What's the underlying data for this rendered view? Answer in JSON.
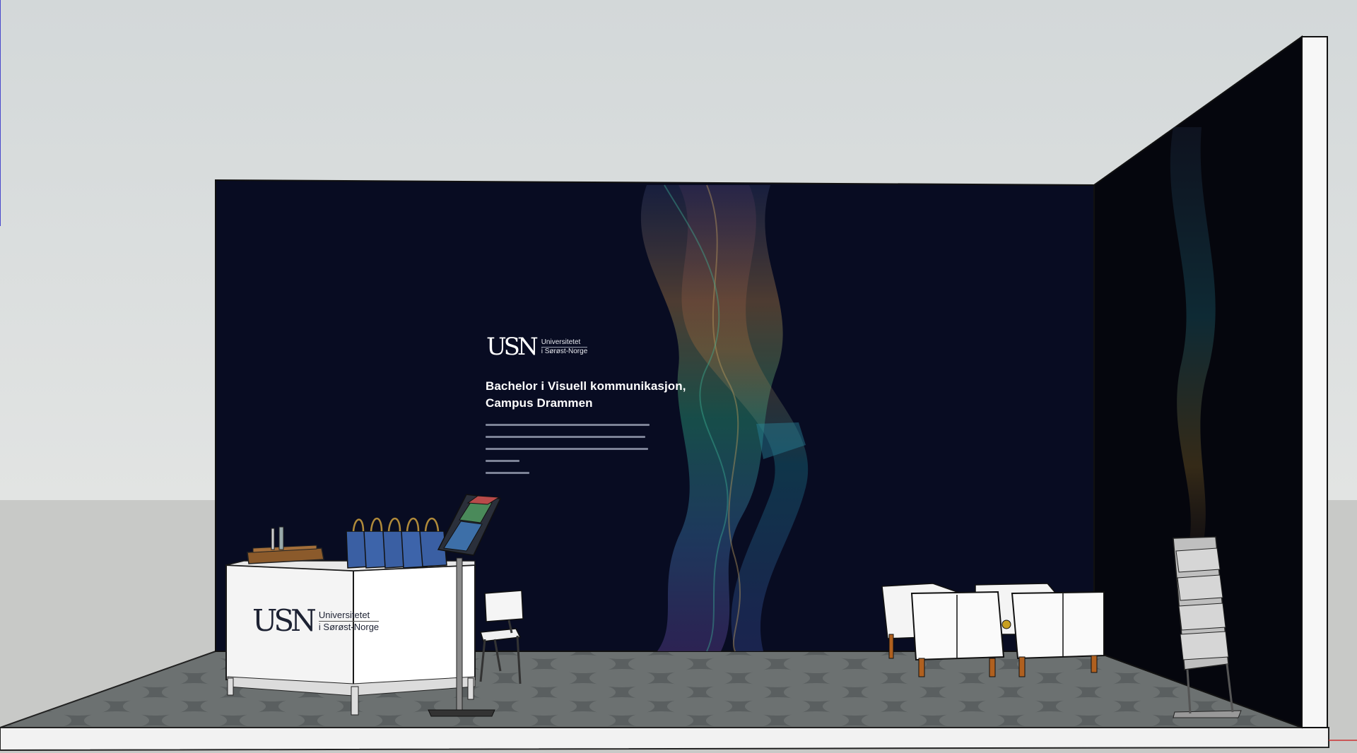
{
  "brand": {
    "logo_mark": "USN",
    "name_line1": "Universitetet",
    "name_line2": "i Sørøst-Norge"
  },
  "wall_banner": {
    "title_line1": "Bachelor i Visuell kommunikasjon,",
    "title_line2": "Campus Drammen"
  },
  "colors": {
    "sky": "#d9dcdd",
    "wall_navy": "#080c22",
    "side_wall": "#05060d",
    "floor": "#5b6060",
    "ground": "#c9cac8",
    "bag_blue": "#3a5fa3",
    "counter_white": "#f7f7f7"
  },
  "icons": {
    "logo": "usn-logo-icon",
    "bags": "tote-bag-icon",
    "chair": "chair-icon",
    "armchair": "armchair-icon",
    "brochure_rack": "brochure-rack-icon"
  }
}
